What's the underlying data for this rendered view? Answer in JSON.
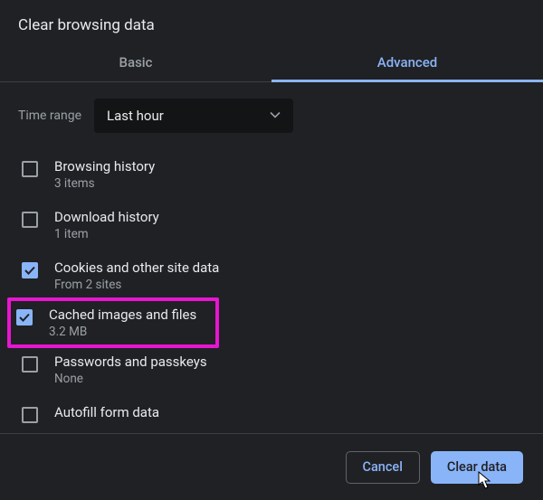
{
  "title": "Clear browsing data",
  "tabs": {
    "basic": "Basic",
    "advanced": "Advanced",
    "active": "advanced"
  },
  "time": {
    "label": "Time range",
    "value": "Last hour"
  },
  "items": [
    {
      "title": "Browsing history",
      "sub": "3 items",
      "checked": false
    },
    {
      "title": "Download history",
      "sub": "1 item",
      "checked": false
    },
    {
      "title": "Cookies and other site data",
      "sub": "From 2 sites",
      "checked": true
    },
    {
      "title": "Cached images and files",
      "sub": "3.2 MB",
      "checked": true,
      "highlight": true
    },
    {
      "title": "Passwords and passkeys",
      "sub": "None",
      "checked": false
    },
    {
      "title": "Autofill form data",
      "sub": "",
      "checked": false,
      "last": true
    }
  ],
  "buttons": {
    "cancel": "Cancel",
    "confirm": "Clear data"
  },
  "colors": {
    "accent": "#8ab4f8",
    "highlight": "#e815d1",
    "bg": "#202124"
  }
}
